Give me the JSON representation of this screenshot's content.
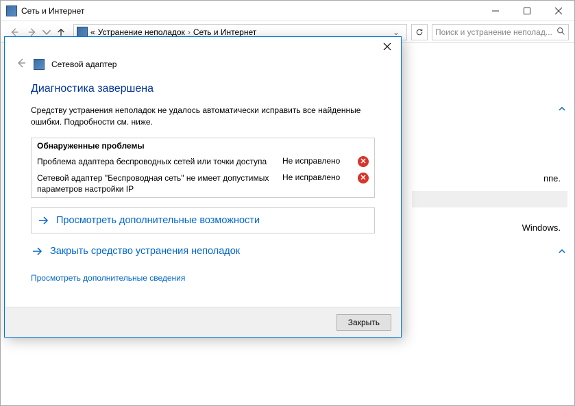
{
  "parent_window": {
    "title": "Сеть и Интернет"
  },
  "breadcrumb": {
    "prefix": "«",
    "item1": "Устранение неполадок",
    "item2": "Сеть и Интернет"
  },
  "search": {
    "placeholder": "Поиск и устранение неполад..."
  },
  "bg": {
    "line1_suffix": "ппе.",
    "line2_suffix": "Windows."
  },
  "dialog": {
    "adapter_title": "Сетевой адаптер",
    "heading": "Диагностика завершена",
    "description": "Средству устранения неполадок не удалось автоматически исправить все найденные ошибки. Подробности см. ниже.",
    "problems_header": "Обнаруженные проблемы",
    "problems": [
      {
        "text": "Проблема адаптера беспроводных сетей или точки доступа",
        "status": "Не исправлено"
      },
      {
        "text": "Сетевой адаптер \"Беспроводная сеть\" не имеет допустимых параметров настройки IP",
        "status": "Не исправлено"
      }
    ],
    "action1": "Просмотреть дополнительные возможности",
    "action2": "Закрыть средство устранения неполадок",
    "details_link": "Просмотреть дополнительные сведения",
    "close_button": "Закрыть"
  }
}
